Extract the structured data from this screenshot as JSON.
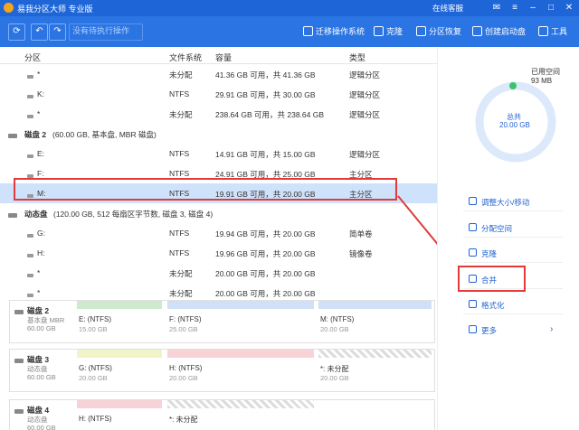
{
  "app": {
    "title": "易我分区大师 专业版",
    "service": "在线客服"
  },
  "toolbar": {
    "pending": "没有待执行操作",
    "tools": [
      "迁移操作系统",
      "克隆",
      "分区恢复",
      "创建启动盘",
      "工具"
    ]
  },
  "table": {
    "headers": [
      "分区",
      "文件系统",
      "容量",
      "类型"
    ],
    "groups": [
      {
        "row_type": "part",
        "name": "*",
        "fs": "未分配",
        "cap": "41.36 GB  可用，共  41.36 GB",
        "type": "逻辑分区"
      },
      {
        "row_type": "part",
        "name": "K:",
        "fs": "NTFS",
        "cap": "29.91 GB  可用，共  30.00 GB",
        "type": "逻辑分区"
      },
      {
        "row_type": "part",
        "name": "*",
        "fs": "未分配",
        "cap": "238.64 GB 可用，共  238.64 GB",
        "type": "逻辑分区"
      },
      {
        "row_type": "disk",
        "name": "磁盘 2",
        "info": "(60.00 GB, 基本盘, MBR 磁盘)"
      },
      {
        "row_type": "part",
        "name": "E:",
        "fs": "NTFS",
        "cap": "14.91 GB  可用，共  15.00 GB",
        "type": "逻辑分区"
      },
      {
        "row_type": "part",
        "name": "F:",
        "fs": "NTFS",
        "cap": "24.91 GB  可用，共  25.00 GB",
        "type": "主分区"
      },
      {
        "row_type": "part",
        "name": "M:",
        "fs": "NTFS",
        "cap": "19.91 GB  可用，共  20.00 GB",
        "type": "主分区",
        "selected": true
      },
      {
        "row_type": "disk",
        "name": "动态盘",
        "info": "(120.00 GB, 512 每扇区字节数, 磁盘 3, 磁盘 4)"
      },
      {
        "row_type": "part",
        "name": "G:",
        "fs": "NTFS",
        "cap": "19.94 GB  可用，共  20.00 GB",
        "type": "简单卷"
      },
      {
        "row_type": "part",
        "name": "H:",
        "fs": "NTFS",
        "cap": "19.96 GB  可用，共  20.00 GB",
        "type": "镜像卷"
      },
      {
        "row_type": "part",
        "name": "*",
        "fs": "未分配",
        "cap": "20.00 GB  可用，共  20.00 GB",
        "type": ""
      },
      {
        "row_type": "part",
        "name": "*",
        "fs": "未分配",
        "cap": "20.00 GB  可用，共  20.00 GB",
        "type": ""
      }
    ]
  },
  "cards": [
    {
      "name": "磁盘 2",
      "sub1": "基本盘 MBR",
      "sub2": "60.00 GB",
      "parts": [
        {
          "label": "E: (NTFS)",
          "size": "15.00 GB",
          "color": "#cfe9cf"
        },
        {
          "label": "F: (NTFS)",
          "size": "25.00 GB",
          "color": "#cfe0f7"
        },
        {
          "label": "M: (NTFS)",
          "size": "20.00 GB",
          "color": "#cfe0f7"
        }
      ]
    },
    {
      "name": "磁盘 3",
      "sub1": "动态盘",
      "sub2": "60.00 GB",
      "parts": [
        {
          "label": "G: (NTFS)",
          "size": "20.00 GB",
          "color": "#f1f3c8"
        },
        {
          "label": "H: (NTFS)",
          "size": "20.00 GB",
          "color": "#f7d3d8"
        },
        {
          "label": "*: 未分配",
          "size": "20.00 GB",
          "color": "checker"
        }
      ]
    },
    {
      "name": "磁盘 4",
      "sub1": "动态盘",
      "sub2": "60.00 GB",
      "parts": [
        {
          "label": "H: (NTFS)",
          "size": "",
          "color": "#f7d3d8"
        },
        {
          "label": "*: 未分配",
          "size": "",
          "color": "checker"
        }
      ]
    }
  ],
  "right": {
    "used_label": "已用空间",
    "used_value": "93 MB",
    "total_label": "总共",
    "total_value": "20.00 GB",
    "actions": [
      "调整大小/移动",
      "分配空间",
      "克隆",
      "合并",
      "格式化",
      "更多"
    ]
  },
  "colors": {
    "accent": "#1e66d8",
    "selected": "#cfe2fb",
    "highlight": "#e23a3a"
  }
}
